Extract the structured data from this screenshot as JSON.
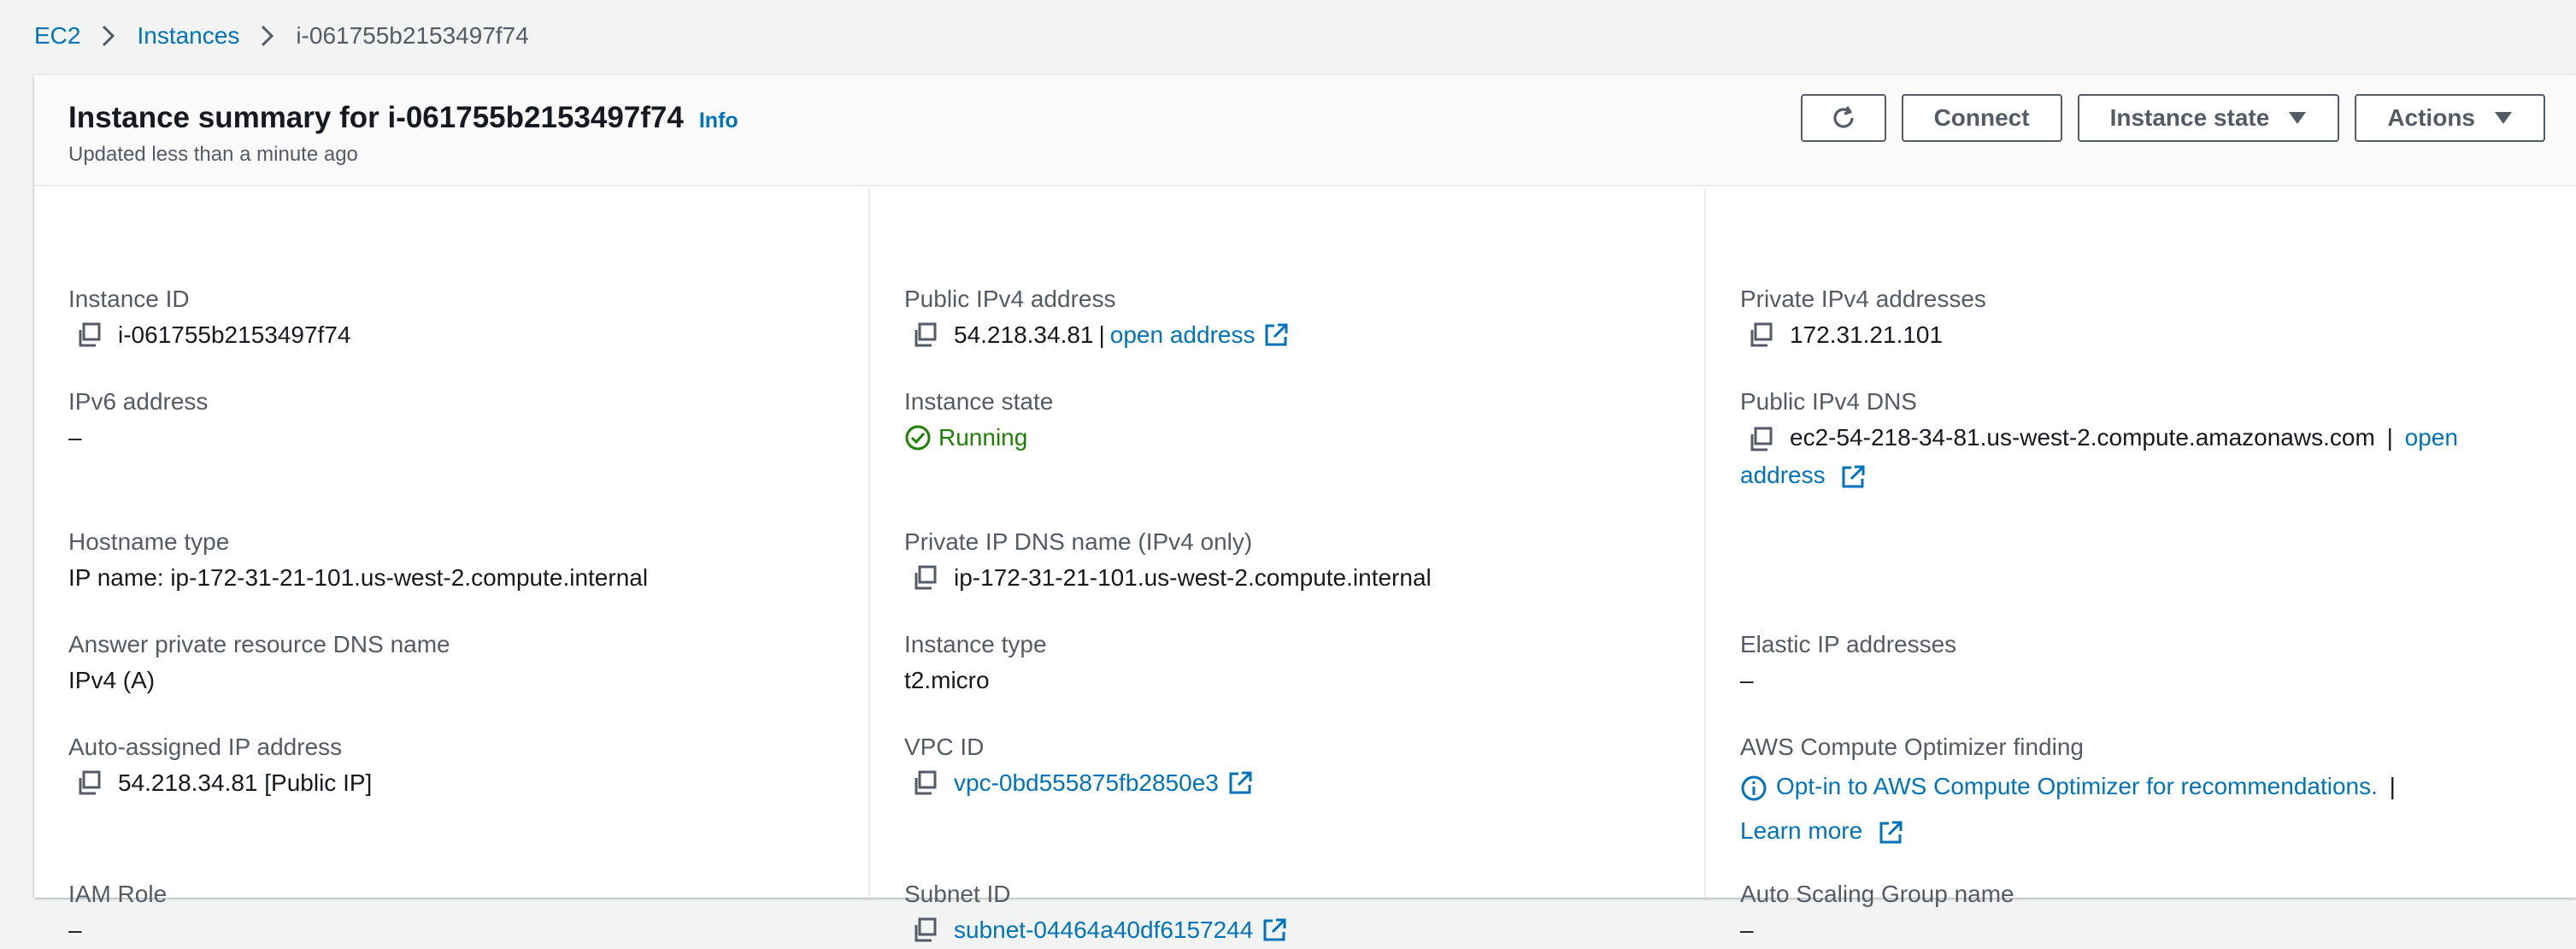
{
  "breadcrumb": {
    "items": [
      "EC2",
      "Instances"
    ],
    "current": "i-061755b2153497f74"
  },
  "header": {
    "title": "Instance summary for i-061755b2153497f74",
    "info": "Info",
    "subtitle": "Updated less than a minute ago",
    "buttons": {
      "connect": "Connect",
      "instance_state": "Instance state",
      "actions": "Actions"
    }
  },
  "fields": {
    "instance_id": {
      "label": "Instance ID",
      "value": "i-061755b2153497f74"
    },
    "public_ipv4": {
      "label": "Public IPv4 address",
      "value": "54.218.34.81",
      "sep": "|",
      "link": "open address"
    },
    "private_ipv4": {
      "label": "Private IPv4 addresses",
      "value": "172.31.21.101"
    },
    "ipv6": {
      "label": "IPv6 address",
      "value": "–"
    },
    "instance_state": {
      "label": "Instance state",
      "value": "Running"
    },
    "public_dns": {
      "label": "Public IPv4 DNS",
      "value": "ec2-54-218-34-81.us-west-2.compute.amazonaws.com",
      "sep": "|",
      "link_part1": "open",
      "link_part2": "address"
    },
    "hostname_type": {
      "label": "Hostname type",
      "value": "IP name: ip-172-31-21-101.us-west-2.compute.internal"
    },
    "private_dns": {
      "label": "Private IP DNS name (IPv4 only)",
      "value": "ip-172-31-21-101.us-west-2.compute.internal"
    },
    "answer_dns": {
      "label": "Answer private resource DNS name",
      "value": "IPv4 (A)"
    },
    "instance_type": {
      "label": "Instance type",
      "value": "t2.micro"
    },
    "elastic_ip": {
      "label": "Elastic IP addresses",
      "value": "–"
    },
    "auto_ip": {
      "label": "Auto-assigned IP address",
      "value": "54.218.34.81 [Public IP]"
    },
    "vpc_id": {
      "label": "VPC ID",
      "value": "vpc-0bd555875fb2850e3"
    },
    "optimizer": {
      "label": "AWS Compute Optimizer finding",
      "link": "Opt-in to AWS Compute Optimizer for recommendations.",
      "sep": "|",
      "learn_more": "Learn more"
    },
    "iam_role": {
      "label": "IAM Role",
      "value": "–"
    },
    "subnet_id": {
      "label": "Subnet ID",
      "value": "subnet-04464a40df6157244"
    },
    "asg_name": {
      "label": "Auto Scaling Group name",
      "value": "–"
    }
  },
  "colors": {
    "link": "#0073bb",
    "running": "#1d8102",
    "label": "#545b64"
  },
  "icons": {
    "copy": "copy-icon",
    "external": "external-link-icon",
    "status": "check-circle-icon",
    "info": "info-circle-icon",
    "refresh": "refresh-icon",
    "caret": "caret-down-icon",
    "chevron": "chevron-right-icon"
  }
}
